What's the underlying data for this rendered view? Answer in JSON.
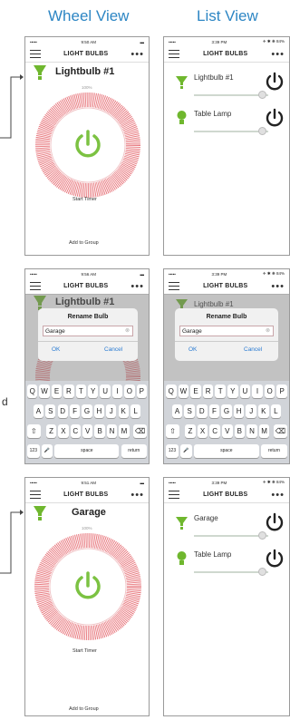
{
  "headers": {
    "wheel": "Wheel View",
    "list": "List View"
  },
  "app": {
    "nav_title": "LIGHT BULBS",
    "more": "•••",
    "start_timer": "Start Timer",
    "add_to_group": "Add to Group",
    "brightness": "100%"
  },
  "status": {
    "s1": {
      "carrier": "•••••",
      "time": "9:50 AM"
    },
    "s2": {
      "carrier": "•••••",
      "time": "3:39 PM",
      "right": "✈ ✱ ❋ 84%"
    },
    "s3": {
      "carrier": "•••••",
      "time": "9:56 AM"
    },
    "s4": {
      "carrier": "•••••",
      "time": "3:39 PM",
      "right": "✈ ✱ ❋ 84%"
    },
    "s5": {
      "carrier": "•••••",
      "time": "9:51 AM"
    },
    "s6": {
      "carrier": "•••••",
      "time": "3:39 PM",
      "right": "✈ ✱ ❋ 84%"
    }
  },
  "bulbs": {
    "original": "Lightbulb #1",
    "renamed": "Garage",
    "second": "Table Lamp"
  },
  "dialog": {
    "title": "Rename Bulb",
    "value": "Garage",
    "ok": "OK",
    "cancel": "Cancel"
  },
  "keyboard": {
    "row1": [
      "Q",
      "W",
      "E",
      "R",
      "T",
      "Y",
      "U",
      "I",
      "O",
      "P"
    ],
    "row2": [
      "A",
      "S",
      "D",
      "F",
      "G",
      "H",
      "J",
      "K",
      "L"
    ],
    "row3": [
      "Z",
      "X",
      "C",
      "V",
      "B",
      "N",
      "M"
    ],
    "num": "123",
    "space": "space",
    "ret": "return"
  },
  "side_label": "d",
  "colors": {
    "accent": "#2d86c4",
    "power": "#7cc242",
    "ring": "#e8797f",
    "bulb": "#6fb72e"
  }
}
